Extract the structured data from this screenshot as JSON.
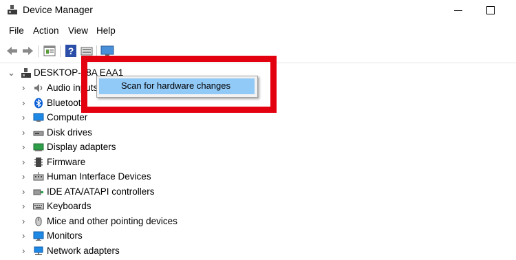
{
  "window": {
    "title": "Device Manager"
  },
  "menubar": {
    "items": [
      "File",
      "Action",
      "View",
      "Help"
    ]
  },
  "toolbar": {
    "buttons": [
      "back-icon",
      "forward-icon",
      "properties-icon",
      "help-icon",
      "update-driver-icon",
      "monitor-icon"
    ]
  },
  "tree": {
    "root": "DESKTOP-38A EAA1",
    "items": [
      {
        "label": "Audio inputs a",
        "icon": "speaker-icon"
      },
      {
        "label": "Bluetooth",
        "icon": "bluetooth-icon"
      },
      {
        "label": "Computer",
        "icon": "computer-icon"
      },
      {
        "label": "Disk drives",
        "icon": "disk-drive-icon"
      },
      {
        "label": "Display adapters",
        "icon": "display-adapter-icon"
      },
      {
        "label": "Firmware",
        "icon": "firmware-icon"
      },
      {
        "label": "Human Interface Devices",
        "icon": "hid-icon"
      },
      {
        "label": "IDE ATA/ATAPI controllers",
        "icon": "ide-controller-icon"
      },
      {
        "label": "Keyboards",
        "icon": "keyboard-icon"
      },
      {
        "label": "Mice and other pointing devices",
        "icon": "mouse-icon"
      },
      {
        "label": "Monitors",
        "icon": "monitor-icon"
      },
      {
        "label": "Network adapters",
        "icon": "network-adapter-icon"
      }
    ]
  },
  "context_menu": {
    "items": [
      "Scan for hardware changes"
    ]
  },
  "colors": {
    "highlight_border": "#e3000f",
    "menu_hover": "#91c9f7",
    "bluetooth": "#0a5fd6"
  }
}
